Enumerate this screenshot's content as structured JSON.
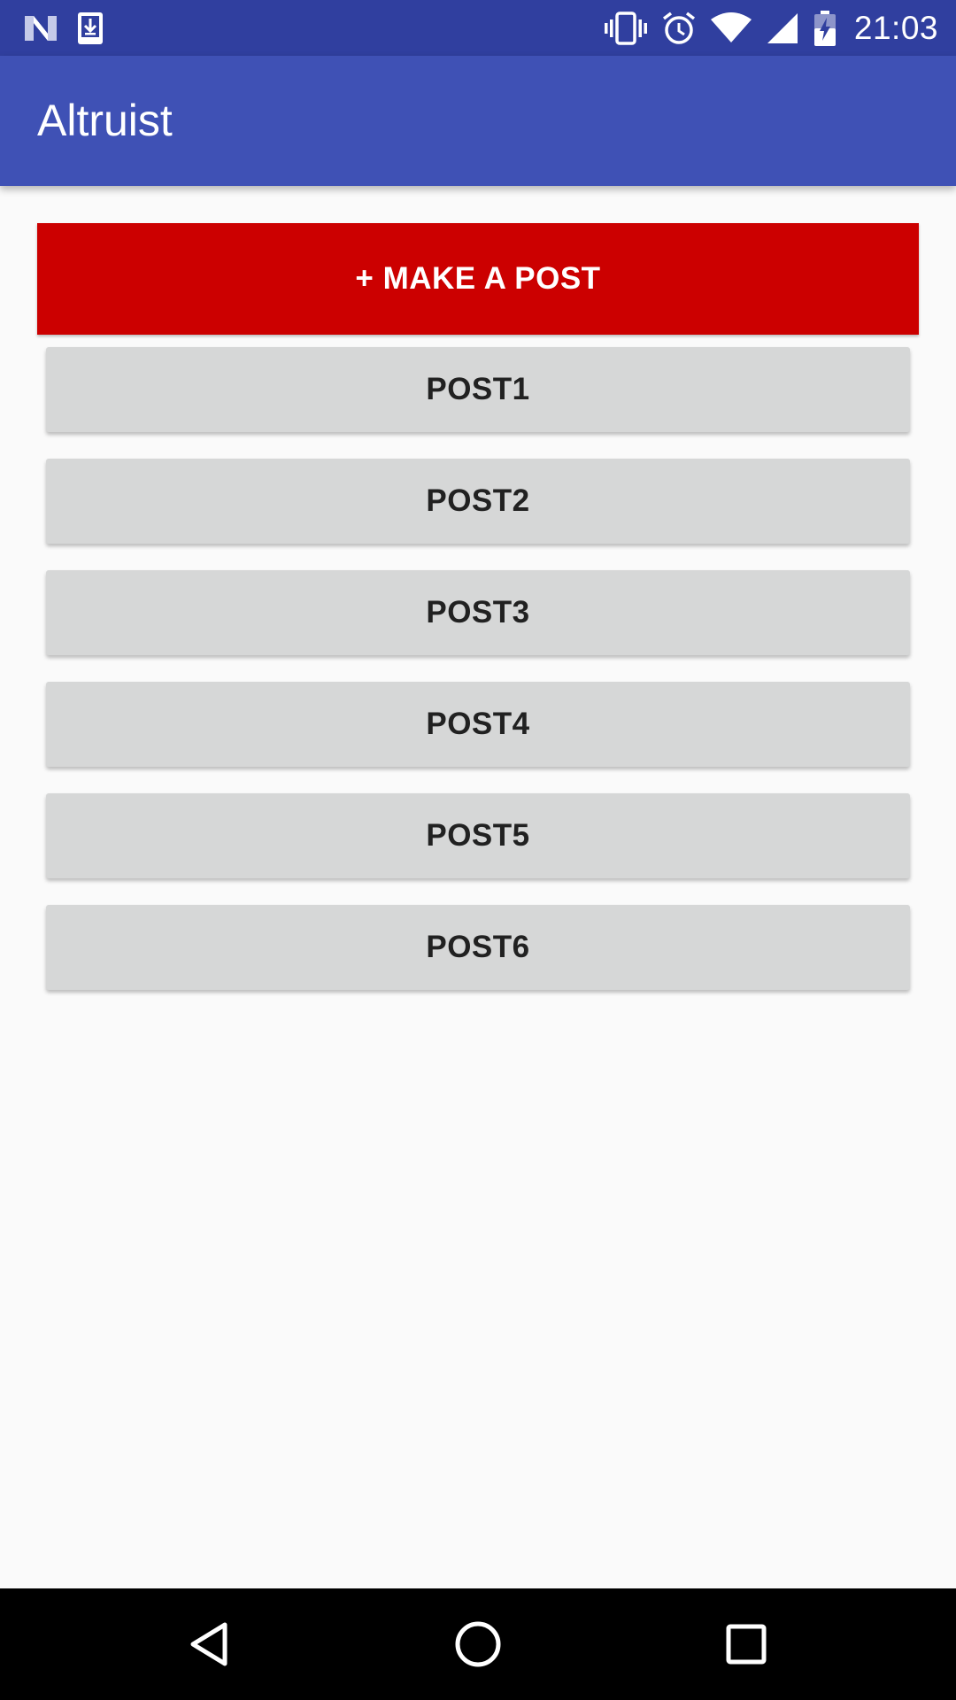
{
  "status_bar": {
    "time": "21:03",
    "left_icons": [
      "n-logo-icon",
      "download-icon"
    ],
    "right_icons": [
      "vibrate-icon",
      "alarm-icon",
      "wifi-icon",
      "cell-signal-icon",
      "battery-charging-icon"
    ]
  },
  "app_bar": {
    "title": "Altruist"
  },
  "main": {
    "make_post_label": "+ MAKE A POST",
    "posts": [
      {
        "label": "POST1"
      },
      {
        "label": "POST2"
      },
      {
        "label": "POST3"
      },
      {
        "label": "POST4"
      },
      {
        "label": "POST5"
      },
      {
        "label": "POST6"
      }
    ]
  },
  "nav_bar": {
    "icons": [
      "back-icon",
      "home-icon",
      "recents-icon"
    ]
  },
  "colors": {
    "status_bar": "#303F9F",
    "app_bar": "#3F51B5",
    "make_post_button": "#CC0000",
    "post_button": "#D6D7D7",
    "background": "#FAFAFA"
  }
}
